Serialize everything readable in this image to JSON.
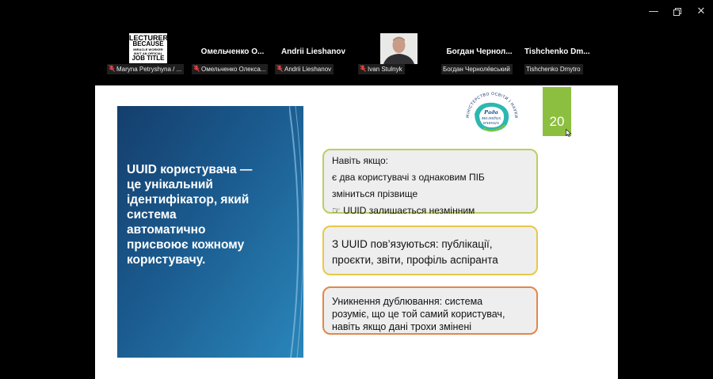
{
  "window": {
    "minimize_icon": "minimize-icon",
    "restore_icon": "restore-icon",
    "close_icon": "close-icon"
  },
  "participants": [
    {
      "name": "",
      "label": "Maryna Petryshyna / ...",
      "muted": true,
      "avatar_text": {
        "line1": "LECTURER",
        "line2": "BECAUSE",
        "line3": "MIRACLE WORKER ISN'T AN OFFICIAL",
        "line4": "JOB TITLE"
      }
    },
    {
      "name": "Омельченко  О...",
      "label": "Омельченко Олекса...",
      "muted": true
    },
    {
      "name": "Andrii Lieshanov",
      "label": "Andrii Lieshanov",
      "muted": true
    },
    {
      "name": "",
      "label": "Ivan Stulnyk",
      "muted": true
    },
    {
      "name": "Богдан  Чернол...",
      "label": "Богдан Черноле́вський",
      "muted": false
    },
    {
      "name": "Tishchenko  Dm...",
      "label": "Tishchenko Dmytro",
      "muted": false
    }
  ],
  "slide": {
    "main_text": [
      "UUID користувача —",
      "це унікальний",
      "ідентифікатор, який",
      "система",
      "автоматично",
      "присвоює кожному",
      "користувачу."
    ],
    "page_number": "20",
    "logo": {
      "inner_line1": "Рада",
      "inner_line2": "молодих",
      "inner_line3": "вчених",
      "ring_text": "МІНІСТЕРСТВО  ОСВІТИ  І  НАУКИ  УКРАЇНИ"
    },
    "box1": [
      "Навіть якщо:",
      "є два користувачі з однаковим ПІБ",
      "зміниться прізвище",
      "☞ UUID залишається незмінним"
    ],
    "box2": [
      "З UUID пов’язуються: публікації,",
      "проєкти, звіти, профіль аспіранта"
    ],
    "box3": [
      "Уникнення дублювання: система",
      "розуміє, що це той самий користувач,",
      "навіть якщо дані трохи змінені"
    ]
  },
  "colors": {
    "panel_dark": "#143e6c",
    "panel_light": "#2a86ba",
    "green": "#8cbf3f",
    "box1_border": "#b9cf62",
    "box2_border": "#e7c849",
    "box3_border": "#e1874a"
  }
}
